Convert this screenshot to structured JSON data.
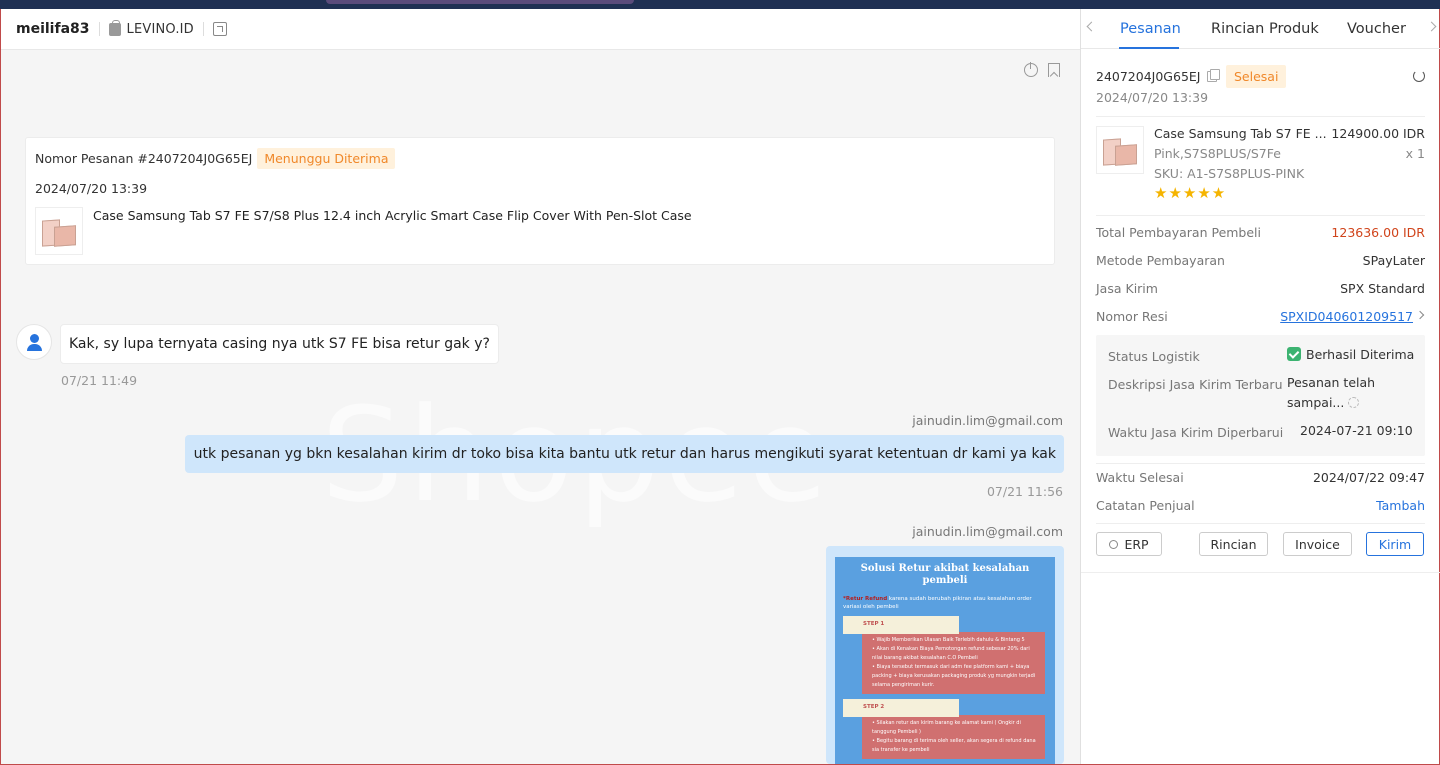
{
  "chat": {
    "username": "meilifa83",
    "shop": "LEVINO.ID",
    "watermark": "Shopee",
    "order_card": {
      "order_no": "Nomor Pesanan #2407204J0G65EJ",
      "status": "Menunggu Diterima",
      "date": "2024/07/20 13:39",
      "product": "Case Samsung Tab S7 FE S7/S8 Plus 12.4 inch Acrylic Smart Case Flip Cover With Pen-Slot Case"
    },
    "messages": [
      {
        "direction": "in",
        "text": "Kak, sy lupa ternyata casing nya utk S7 FE bisa retur gak y?",
        "time": "07/21 11:49"
      },
      {
        "direction": "out",
        "sender": "jainudin.lim@gmail.com",
        "text": "utk pesanan yg bkn kesalahan kirim dr toko bisa kita bantu utk retur dan harus mengikuti syarat ketentuan dr kami ya kak",
        "time": "07/21 11:56"
      },
      {
        "direction": "out",
        "sender": "jainudin.lim@gmail.com",
        "type": "image"
      }
    ],
    "image": {
      "title": "Solusi Retur akibat kesalahan pembeli",
      "intro_bold": "*Retur Refund",
      "intro": " karena sudah berubah pikiran atau kesalahan order variasi oleh pembeli",
      "step1": "STEP 1",
      "step1_lines": [
        "• Wajib Memberikan Ulasan Baik Terlebih dahulu & Bintang 5",
        "• Akan di Kenakan Biaya Pemotongan refund sebesar 20% dari nilai barang akibat kesalahan C.O Pembeli",
        "• Biaya tersebut termasuk dari adm fee platform kami + biaya packing + biaya kerusakan packaging produk yg mungkin terjadi selama pengiriman kurir."
      ],
      "step2": "STEP 2",
      "step2_lines": [
        "• Silakan retur dan kirim barang ke alamat kami ( Ongkir di tanggung Pembeli )",
        "• Begitu barang di terima oleh seller, akan segera di refund dana sia transfer ke pembeli"
      ]
    }
  },
  "panel": {
    "tabs": [
      "Pesanan",
      "Rincian Produk",
      "Voucher"
    ],
    "active_tab": "Pesanan",
    "order_id": "2407204J0G65EJ",
    "status": "Selesai",
    "order_time": "2024/07/20 13:39",
    "product": {
      "name": "Case Samsung Tab S7 FE ...",
      "price": "124900.00 IDR",
      "variant": "Pink,S7S8PLUS/S7Fe",
      "qty": "x 1",
      "sku": "SKU:  A1-S7S8PLUS-PINK",
      "rating": 5,
      "stars": "★★★★★"
    },
    "rows": {
      "total_label": "Total Pembayaran Pembeli",
      "total_value": "123636.00 IDR",
      "method_label": "Metode Pembayaran",
      "method_value": "SPayLater",
      "courier_label": "Jasa Kirim",
      "courier_value": "SPX Standard",
      "resi_label": "Nomor Resi",
      "resi_value": "SPXID040601209517",
      "done_label": "Waktu Selesai",
      "done_value": "2024/07/22 09:47",
      "note_label": "Catatan Penjual",
      "note_value": "Tambah"
    },
    "logistics": {
      "status_label": "Status Logistik",
      "status_value": "Berhasil Diterima",
      "desc_label": "Deskripsi Jasa Kirim Terbaru",
      "desc_value_1": "Pesanan telah",
      "desc_value_2": "sampai...",
      "time_label": "Waktu Jasa Kirim Diperbarui",
      "time_value": "2024-07-21 09:10"
    },
    "buttons": {
      "erp": "ERP",
      "detail": "Rincian",
      "invoice": "Invoice",
      "send": "Kirim"
    },
    "colors": {
      "accent": "#2673dd",
      "warning": "#f0882a",
      "price": "#d0441b"
    }
  }
}
